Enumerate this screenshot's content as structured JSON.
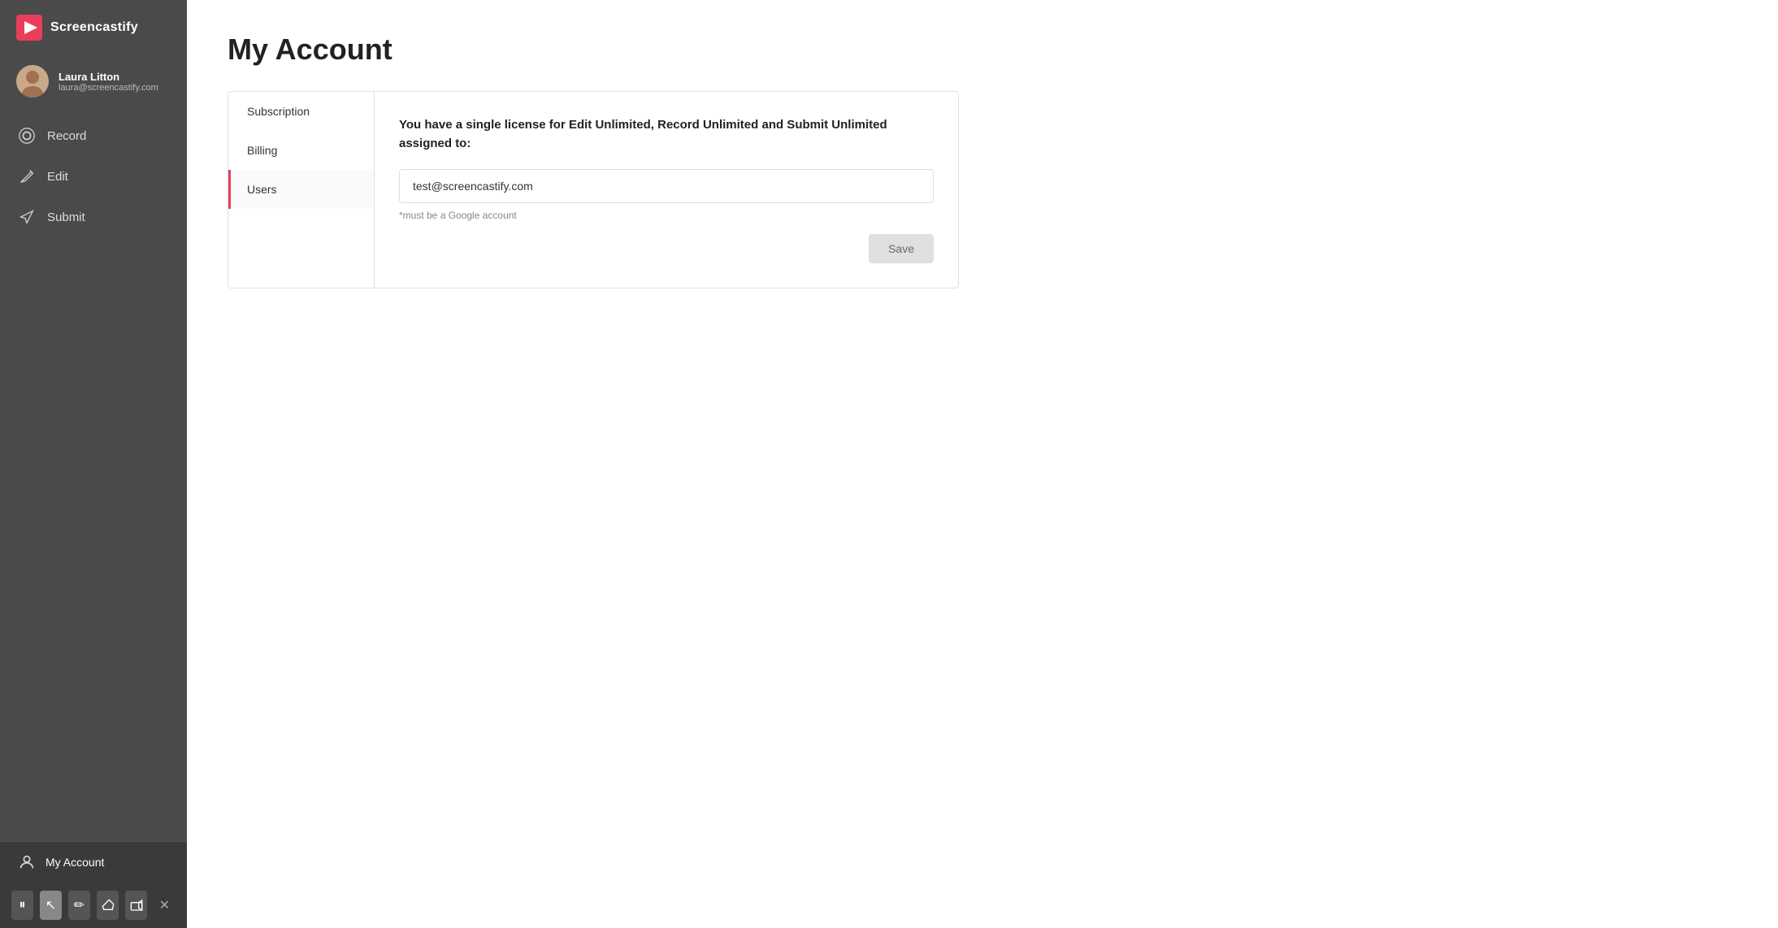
{
  "app": {
    "name": "Screencastify"
  },
  "user": {
    "name": "Laura Litton",
    "email": "laura@screencastify.com"
  },
  "sidebar": {
    "nav_items": [
      {
        "id": "record",
        "label": "Record",
        "icon": "record"
      },
      {
        "id": "edit",
        "label": "Edit",
        "icon": "edit"
      },
      {
        "id": "submit",
        "label": "Submit",
        "icon": "submit"
      }
    ]
  },
  "bottom": {
    "my_account_label": "My Account"
  },
  "toolbar": {
    "buttons": [
      {
        "id": "pause",
        "label": "⏸",
        "title": "Pause"
      },
      {
        "id": "cursor",
        "label": "↖",
        "title": "Cursor"
      },
      {
        "id": "pen",
        "label": "✏",
        "title": "Pen"
      },
      {
        "id": "eraser",
        "label": "◻",
        "title": "Eraser"
      },
      {
        "id": "camera",
        "label": "🎥",
        "title": "Camera"
      },
      {
        "id": "close",
        "label": "✕",
        "title": "Close"
      }
    ]
  },
  "page": {
    "title": "My Account"
  },
  "account_tabs": [
    {
      "id": "subscription",
      "label": "Subscription",
      "active": false
    },
    {
      "id": "billing",
      "label": "Billing",
      "active": false
    },
    {
      "id": "users",
      "label": "Users",
      "active": true
    }
  ],
  "users_panel": {
    "license_text": "You have a single license for Edit Unlimited, Record Unlimited and Submit Unlimited assigned to:",
    "email_value": "test@screencastify.com",
    "email_placeholder": "test@screencastify.com",
    "must_google_note": "*must be a Google account",
    "save_label": "Save"
  }
}
